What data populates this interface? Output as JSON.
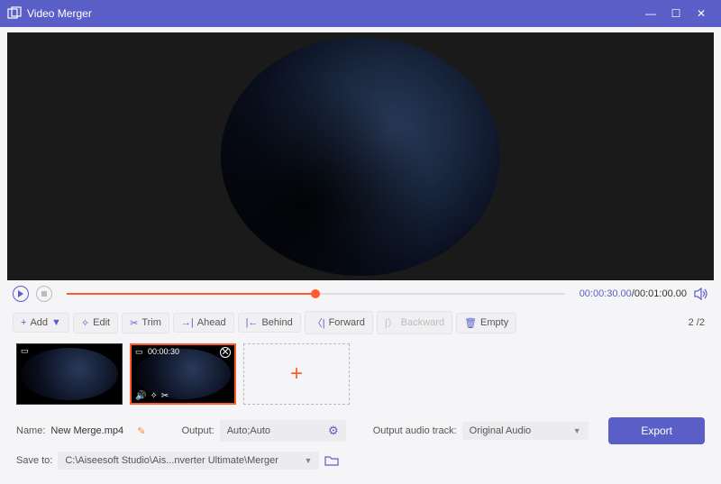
{
  "window": {
    "title": "Video Merger"
  },
  "playback": {
    "current_time": "00:00:30.00",
    "total_time": "00:01:00.00",
    "progress_percent": 50
  },
  "toolbar": {
    "add": "Add",
    "edit": "Edit",
    "trim": "Trim",
    "ahead": "Ahead",
    "behind": "Behind",
    "forward": "Forward",
    "backward": "Backward",
    "empty": "Empty",
    "counter_current": "2",
    "counter_total": "2"
  },
  "clips": [
    {
      "time": "",
      "active": false
    },
    {
      "time": "00:00:30",
      "active": true
    }
  ],
  "footer": {
    "name_label": "Name:",
    "name_value": "New Merge.mp4",
    "output_label": "Output:",
    "output_value": "Auto;Auto",
    "audio_label": "Output audio track:",
    "audio_value": "Original Audio",
    "save_label": "Save to:",
    "save_value": "C:\\Aiseesoft Studio\\Ais...nverter Ultimate\\Merger",
    "export": "Export"
  }
}
